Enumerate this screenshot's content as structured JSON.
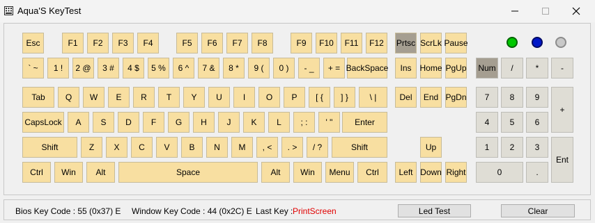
{
  "window": {
    "title": "Aqua'S KeyTest",
    "minimize_glyph": "—",
    "maximize_glyph": "☐",
    "close_glyph": "✕"
  },
  "leds": [
    {
      "name": "led-green",
      "color": "#00c800",
      "border": "#006400"
    },
    {
      "name": "led-blue",
      "color": "#0018c8",
      "border": "#000a64"
    },
    {
      "name": "led-gray",
      "color": "#c8c8c8",
      "border": "#8c8c8c"
    }
  ],
  "keys": [
    {
      "label": "Esc",
      "name": "key-esc"
    },
    {
      "label": "F1",
      "name": "key-f1"
    },
    {
      "label": "F2",
      "name": "key-f2"
    },
    {
      "label": "F3",
      "name": "key-f3"
    },
    {
      "label": "F4",
      "name": "key-f4"
    },
    {
      "label": "F5",
      "name": "key-f5"
    },
    {
      "label": "F6",
      "name": "key-f6"
    },
    {
      "label": "F7",
      "name": "key-f7"
    },
    {
      "label": "F8",
      "name": "key-f8"
    },
    {
      "label": "F9",
      "name": "key-f9"
    },
    {
      "label": "F10",
      "name": "key-f10"
    },
    {
      "label": "F11",
      "name": "key-f11"
    },
    {
      "label": "F12",
      "name": "key-f12"
    },
    {
      "label": "Prtsc",
      "name": "key-prtsc",
      "pressed": true
    },
    {
      "label": "ScrLk",
      "name": "key-scrlk"
    },
    {
      "label": "Pause",
      "name": "key-pause"
    },
    {
      "label": "` ~",
      "name": "key-backtick"
    },
    {
      "label": "1 !",
      "name": "key-1"
    },
    {
      "label": "2 @",
      "name": "key-2"
    },
    {
      "label": "3 #",
      "name": "key-3"
    },
    {
      "label": "4 $",
      "name": "key-4"
    },
    {
      "label": "5 %",
      "name": "key-5"
    },
    {
      "label": "6 ^",
      "name": "key-6"
    },
    {
      "label": "7 &",
      "name": "key-7"
    },
    {
      "label": "8 *",
      "name": "key-8"
    },
    {
      "label": "9 (",
      "name": "key-9"
    },
    {
      "label": "0 )",
      "name": "key-0"
    },
    {
      "label": "- _",
      "name": "key-minus"
    },
    {
      "label": "+ =",
      "name": "key-equals"
    },
    {
      "label": "BackSpace",
      "name": "key-backspace"
    },
    {
      "label": "Ins",
      "name": "key-ins"
    },
    {
      "label": "Home",
      "name": "key-home"
    },
    {
      "label": "PgUp",
      "name": "key-pgup"
    },
    {
      "label": "Num",
      "name": "key-numlock",
      "numpad": true,
      "pressed": true
    },
    {
      "label": "/",
      "name": "key-np-divide",
      "numpad": true
    },
    {
      "label": "*",
      "name": "key-np-multiply",
      "numpad": true
    },
    {
      "label": "-",
      "name": "key-np-minus",
      "numpad": true
    },
    {
      "label": "Tab",
      "name": "key-tab"
    },
    {
      "label": "Q",
      "name": "key-q"
    },
    {
      "label": "W",
      "name": "key-w"
    },
    {
      "label": "E",
      "name": "key-e"
    },
    {
      "label": "R",
      "name": "key-r"
    },
    {
      "label": "T",
      "name": "key-t"
    },
    {
      "label": "Y",
      "name": "key-y"
    },
    {
      "label": "U",
      "name": "key-u"
    },
    {
      "label": "I",
      "name": "key-i"
    },
    {
      "label": "O",
      "name": "key-o"
    },
    {
      "label": "P",
      "name": "key-p"
    },
    {
      "label": "[ {",
      "name": "key-lbracket"
    },
    {
      "label": "] }",
      "name": "key-rbracket"
    },
    {
      "label": "\\ |",
      "name": "key-backslash"
    },
    {
      "label": "Del",
      "name": "key-del"
    },
    {
      "label": "End",
      "name": "key-end"
    },
    {
      "label": "PgDn",
      "name": "key-pgdn"
    },
    {
      "label": "7",
      "name": "key-np-7",
      "numpad": true
    },
    {
      "label": "8",
      "name": "key-np-8",
      "numpad": true
    },
    {
      "label": "9",
      "name": "key-np-9",
      "numpad": true
    },
    {
      "label": "+",
      "name": "key-np-plus",
      "numpad": true
    },
    {
      "label": "CapsLock",
      "name": "key-capslock"
    },
    {
      "label": "A",
      "name": "key-a"
    },
    {
      "label": "S",
      "name": "key-s"
    },
    {
      "label": "D",
      "name": "key-d"
    },
    {
      "label": "F",
      "name": "key-f"
    },
    {
      "label": "G",
      "name": "key-g"
    },
    {
      "label": "H",
      "name": "key-h"
    },
    {
      "label": "J",
      "name": "key-j"
    },
    {
      "label": "K",
      "name": "key-k"
    },
    {
      "label": "L",
      "name": "key-l"
    },
    {
      "label": "; :",
      "name": "key-semicolon"
    },
    {
      "label": "' \"",
      "name": "key-quote"
    },
    {
      "label": "Enter",
      "name": "key-enter"
    },
    {
      "label": "4",
      "name": "key-np-4",
      "numpad": true
    },
    {
      "label": "5",
      "name": "key-np-5",
      "numpad": true
    },
    {
      "label": "6",
      "name": "key-np-6",
      "numpad": true
    },
    {
      "label": "Shift",
      "name": "key-lshift"
    },
    {
      "label": "Z",
      "name": "key-z"
    },
    {
      "label": "X",
      "name": "key-x"
    },
    {
      "label": "C",
      "name": "key-c"
    },
    {
      "label": "V",
      "name": "key-v"
    },
    {
      "label": "B",
      "name": "key-b"
    },
    {
      "label": "N",
      "name": "key-n"
    },
    {
      "label": "M",
      "name": "key-m"
    },
    {
      "label": ", <",
      "name": "key-comma"
    },
    {
      "label": ". >",
      "name": "key-period"
    },
    {
      "label": "/ ?",
      "name": "key-slash"
    },
    {
      "label": "Shift",
      "name": "key-rshift"
    },
    {
      "label": "Up",
      "name": "key-up"
    },
    {
      "label": "1",
      "name": "key-np-1",
      "numpad": true
    },
    {
      "label": "2",
      "name": "key-np-2",
      "numpad": true
    },
    {
      "label": "3",
      "name": "key-np-3",
      "numpad": true
    },
    {
      "label": "Ent",
      "name": "key-np-enter",
      "numpad": true
    },
    {
      "label": "Ctrl",
      "name": "key-lctrl"
    },
    {
      "label": "Win",
      "name": "key-lwin"
    },
    {
      "label": "Alt",
      "name": "key-lalt"
    },
    {
      "label": "Space",
      "name": "key-space"
    },
    {
      "label": "Alt",
      "name": "key-ralt"
    },
    {
      "label": "Win",
      "name": "key-rwin"
    },
    {
      "label": "Menu",
      "name": "key-menu"
    },
    {
      "label": "Ctrl",
      "name": "key-rctrl"
    },
    {
      "label": "Left",
      "name": "key-left"
    },
    {
      "label": "Down",
      "name": "key-down"
    },
    {
      "label": "Right",
      "name": "key-right"
    },
    {
      "label": "0",
      "name": "key-np-0",
      "numpad": true
    },
    {
      "label": ".",
      "name": "key-np-dot",
      "numpad": true
    }
  ],
  "status": {
    "bios_label": "Bios Key Code : 55 (0x37) E",
    "window_label": "Window Key Code : 44 (0x2C) E",
    "last_key_label": "Last Key :",
    "last_key_value": "PrintScreen",
    "last_key_color": "#e00000",
    "led_test_button": "Led Test",
    "clear_button": "Clear"
  }
}
